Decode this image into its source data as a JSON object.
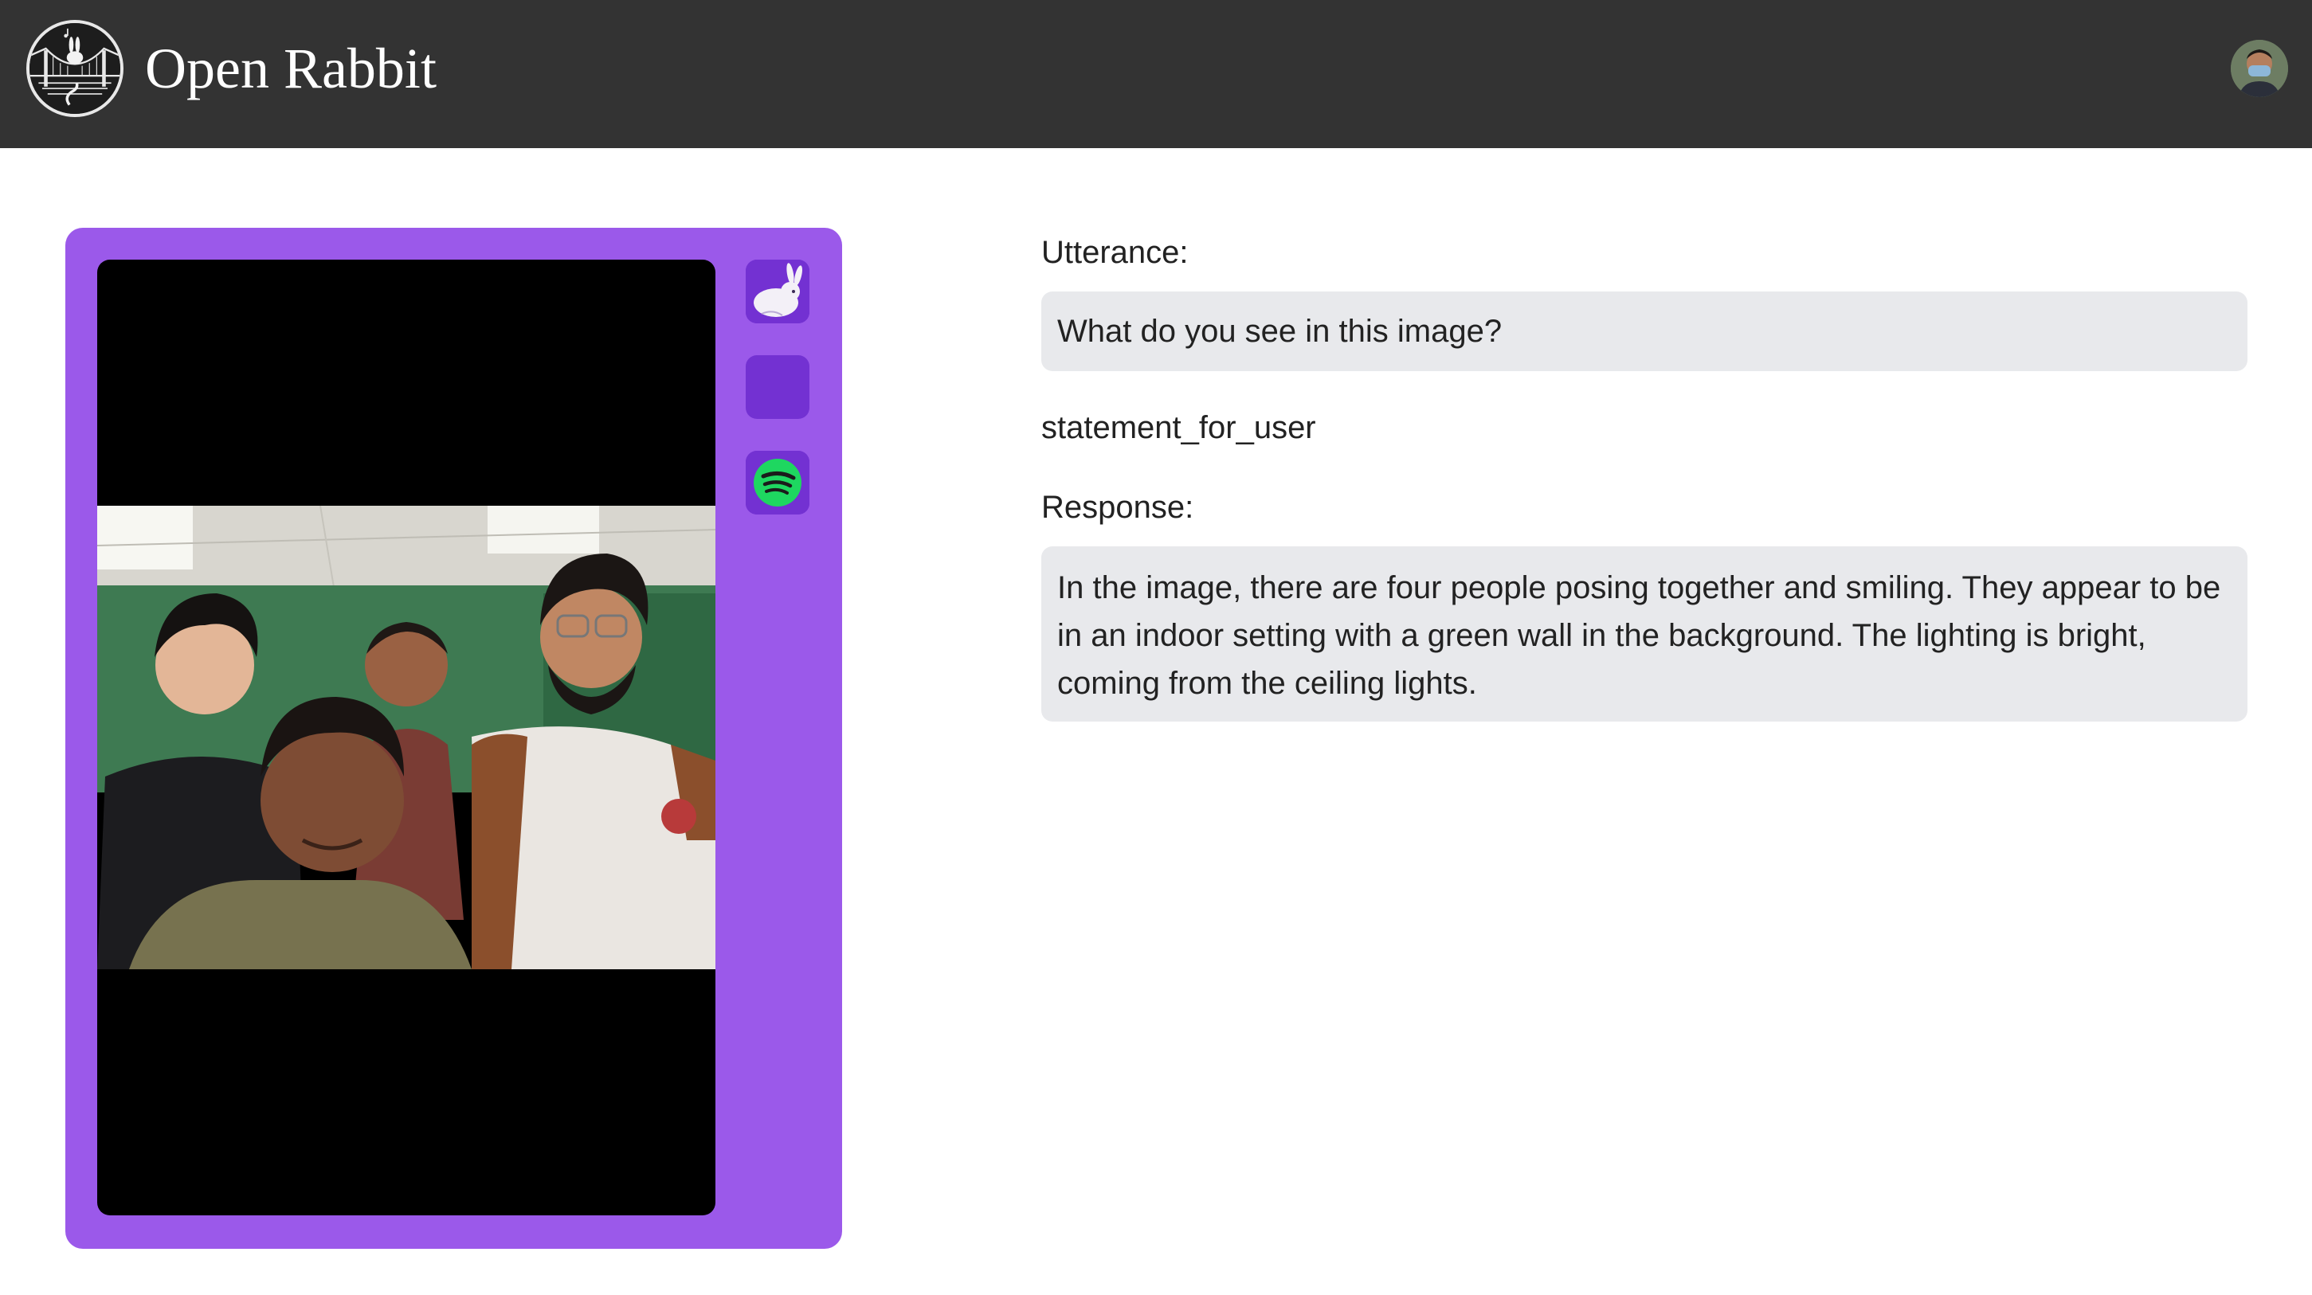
{
  "header": {
    "title": "Open Rabbit",
    "logo_icon": "rabbit-bridge-logo-icon",
    "avatar_icon": "user-avatar-icon"
  },
  "device": {
    "panel_color": "#9b59ea",
    "button_color": "#7331d2",
    "screen_image": "camera-frame-four-people-green-wall",
    "buttons": [
      {
        "name": "rabbit-icon"
      },
      {
        "name": "blank-button"
      },
      {
        "name": "spotify-icon"
      }
    ]
  },
  "conversation": {
    "utterance_label": "Utterance:",
    "utterance_text": "What do you see in this image?",
    "statement_label": "statement_for_user",
    "response_label": "Response:",
    "response_text": "In the image, there are four people posing together and smiling. They appear to be in an indoor setting with a green wall in the background. The lighting is bright, coming from the ceiling lights."
  }
}
